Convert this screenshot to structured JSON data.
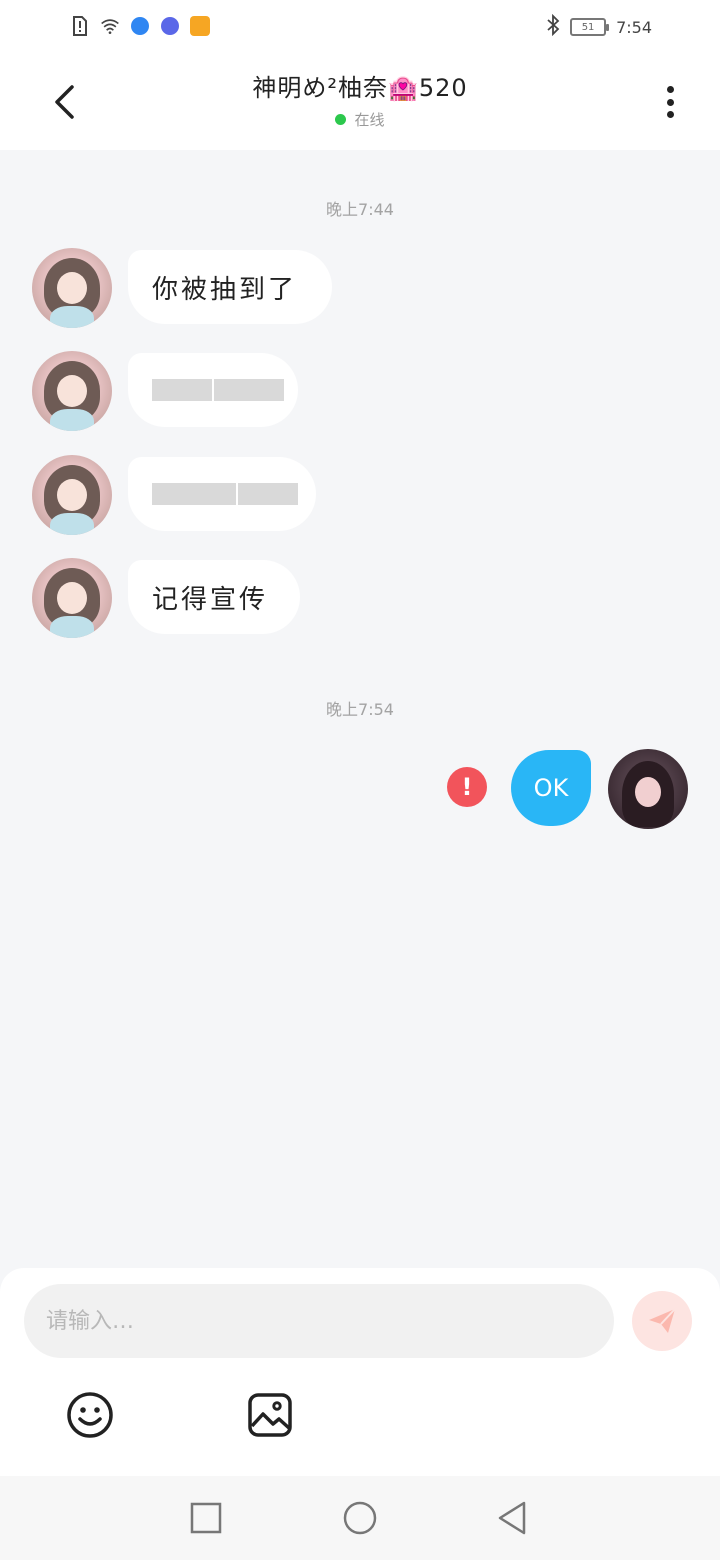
{
  "status_bar": {
    "time": "7:54",
    "battery": "51"
  },
  "header": {
    "title": "神明め²柚奈🏩520",
    "status_text": "在线",
    "online_color": "#2cc84d"
  },
  "messages": {
    "time_1": "晚上7:44",
    "msg_1": "你被抽到了",
    "msg_4": "记得宣传",
    "time_2": "晚上7:54",
    "msg_sent": "OK",
    "error_glyph": "!"
  },
  "composer": {
    "placeholder": "请输入…"
  },
  "icons": {
    "back": "back-arrow-icon",
    "more": "more-vertical-icon",
    "send": "send-icon",
    "emoji": "emoji-icon",
    "image": "image-icon"
  },
  "colors": {
    "sent_bubble": "#29b6f6",
    "error": "#f2545b",
    "background": "#f5f6f8"
  }
}
